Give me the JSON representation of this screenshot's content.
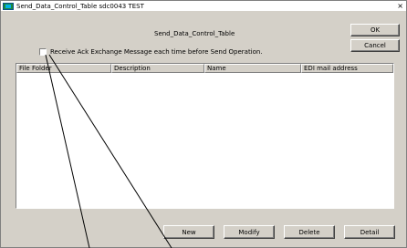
{
  "window": {
    "title": "Send_Data_Control_Table sdc0043 TEST",
    "close_glyph": "×"
  },
  "form_title": "Send_Data_Control_Table",
  "buttons": {
    "ok": "OK",
    "cancel": "Cancel",
    "new": "New",
    "modify": "Modify",
    "delete": "Delete",
    "detail": "Detail"
  },
  "checkbox": {
    "label": "Receive Ack Exchange Message each time before Send Operation.",
    "checked": false
  },
  "table": {
    "columns": [
      "File Folder",
      "Description",
      "Name",
      "EDI mail address"
    ],
    "rows": []
  },
  "icons": {
    "app_icon": "app-window-icon",
    "close": "close-icon"
  }
}
